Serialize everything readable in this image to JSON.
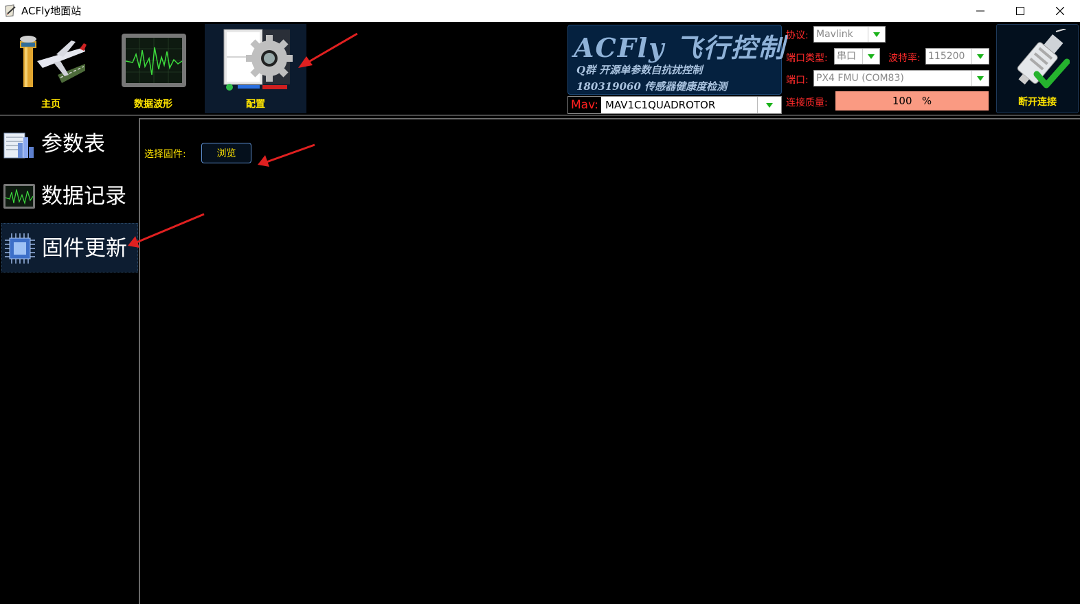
{
  "window": {
    "title": "ACFly地面站",
    "minimize_icon": "minimize-icon",
    "maximize_icon": "maximize-icon",
    "close_icon": "close-icon"
  },
  "nav": {
    "tabs": [
      {
        "label": "主页",
        "icon": "control-tower-airplane-icon"
      },
      {
        "label": "数据波形",
        "icon": "waveform-monitor-icon"
      },
      {
        "label": "配置",
        "icon": "gear-config-icon",
        "active": true
      }
    ]
  },
  "logo": {
    "title": "ACFly 飞行控制",
    "line1": "Q群  开源单参数自抗扰控制",
    "line2": "180319060 传感器健康度检测"
  },
  "mav": {
    "label": "Mav:",
    "value": "MAV1C1QUADROTOR"
  },
  "connection": {
    "protocol_label": "协议:",
    "protocol_value": "Mavlink",
    "port_type_label": "端口类型:",
    "port_type_value": "串口",
    "baud_label": "波特率:",
    "baud_value": "115200",
    "port_label": "端口:",
    "port_value": "PX4 FMU (COM83)",
    "quality_label": "连接质量:",
    "quality_value": "100",
    "quality_unit": "%",
    "quality_bar_color": "#fa9a82"
  },
  "disconnect": {
    "label": "断开连接",
    "icon": "usb-connected-check-icon"
  },
  "sidebar": {
    "items": [
      {
        "label": "参数表",
        "icon": "parameter-table-icon"
      },
      {
        "label": "数据记录",
        "icon": "data-log-icon"
      },
      {
        "label": "固件更新",
        "icon": "chip-firmware-icon",
        "active": true
      }
    ]
  },
  "firmware": {
    "select_label": "选择固件:",
    "browse_label": "浏览"
  },
  "colors": {
    "accent_yellow": "#ffe400",
    "label_red": "#ff2a2a",
    "annotation_arrow": "#e02020"
  }
}
